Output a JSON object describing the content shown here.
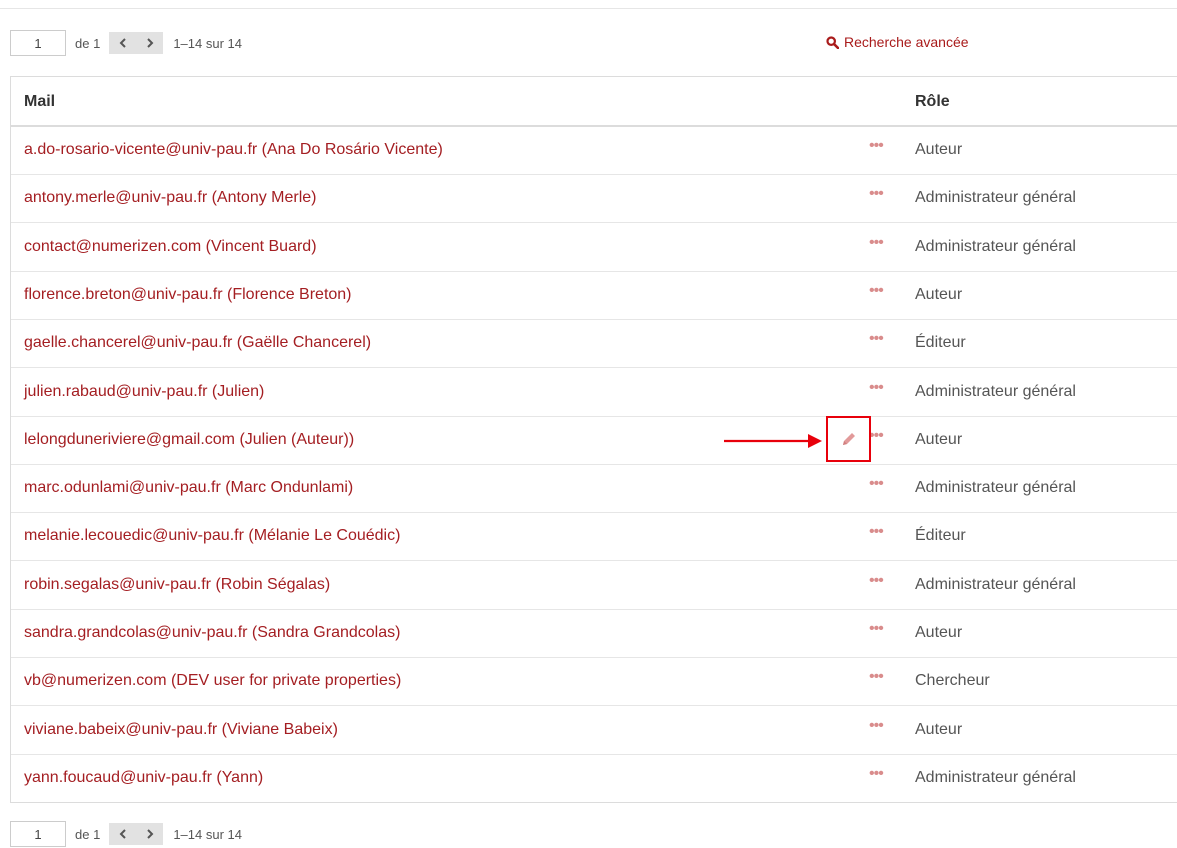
{
  "pager_top": {
    "page": "1",
    "of": "de 1",
    "prev_icon": "chevron-left",
    "next_icon": "chevron-right",
    "range": "1–14 sur 14"
  },
  "pager_bottom": {
    "page": "1",
    "of": "de 1",
    "prev_icon": "chevron-left",
    "next_icon": "chevron-right",
    "range": "1–14 sur 14"
  },
  "advanced_search": {
    "label": "Recherche avancée",
    "icon": "search-icon"
  },
  "table": {
    "headers": {
      "mail": "Mail",
      "role": "Rôle"
    },
    "more_icon": "•••",
    "rows": [
      {
        "mail": "a.do-rosario-vicente@univ-pau.fr (Ana Do Rosário Vicente)",
        "role": "Auteur"
      },
      {
        "mail": "antony.merle@univ-pau.fr (Antony Merle)",
        "role": "Administrateur général"
      },
      {
        "mail": "contact@numerizen.com (Vincent Buard)",
        "role": "Administrateur général"
      },
      {
        "mail": "florence.breton@univ-pau.fr (Florence Breton)",
        "role": "Auteur"
      },
      {
        "mail": "gaelle.chancerel@univ-pau.fr (Gaëlle Chancerel)",
        "role": "Éditeur"
      },
      {
        "mail": "julien.rabaud@univ-pau.fr (Julien)",
        "role": "Administrateur général"
      },
      {
        "mail": "lelongduneriviere@gmail.com (Julien (Auteur))",
        "role": "Auteur"
      },
      {
        "mail": "marc.odunlami@univ-pau.fr (Marc Ondunlami)",
        "role": "Administrateur général"
      },
      {
        "mail": "melanie.lecouedic@univ-pau.fr (Mélanie Le Couédic)",
        "role": "Éditeur"
      },
      {
        "mail": "robin.segalas@univ-pau.fr (Robin Ségalas)",
        "role": "Administrateur général"
      },
      {
        "mail": "sandra.grandcolas@univ-pau.fr (Sandra Grandcolas)",
        "role": "Auteur"
      },
      {
        "mail": "vb@numerizen.com (DEV user for private properties)",
        "role": "Chercheur"
      },
      {
        "mail": "viviane.babeix@univ-pau.fr (Viviane Babeix)",
        "role": "Auteur"
      },
      {
        "mail": "yann.foucaud@univ-pau.fr (Yann)",
        "role": "Administrateur général"
      }
    ]
  },
  "annotation": {
    "arrow_color": "#e8000b",
    "box_color": "#e8000b",
    "target_icon": "pencil-icon"
  },
  "colors": {
    "link": "#a41e22",
    "dots": "#d98c8c",
    "pencil": "#e29a9a"
  }
}
